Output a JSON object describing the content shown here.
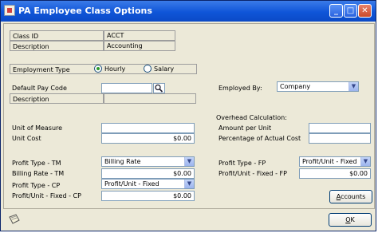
{
  "window": {
    "title": "PA Employee Class Options",
    "min_glyph": "_",
    "max_glyph": "□",
    "close_glyph": "✕"
  },
  "class_id": {
    "label": "Class ID",
    "value": "ACCT"
  },
  "description": {
    "label": "Description",
    "value": "Accounting"
  },
  "employment_type": {
    "label": "Employment Type",
    "options": [
      "Hourly",
      "Salary"
    ],
    "selected": "Hourly"
  },
  "default_pay_code": {
    "label": "Default Pay Code",
    "value": "",
    "desc_label": "Description",
    "desc_value": ""
  },
  "employed_by": {
    "label": "Employed By:",
    "value": "Company"
  },
  "overhead": {
    "title": "Overhead Calculation:",
    "amount_label": "Amount per Unit",
    "amount_value": "",
    "pct_label": "Percentage of Actual Cost",
    "pct_value": ""
  },
  "unit_of_measure": {
    "label": "Unit of Measure",
    "value": ""
  },
  "unit_cost": {
    "label": "Unit Cost",
    "value": "$0.00"
  },
  "profit_type_tm": {
    "label": "Profit Type - TM",
    "value": "Billing Rate"
  },
  "billing_rate_tm": {
    "label": "Billing Rate - TM",
    "value": "$0.00"
  },
  "profit_type_cp": {
    "label": "Profit Type - CP",
    "value": "Profit/Unit - Fixed"
  },
  "profit_unit_fixed_cp": {
    "label": "Profit/Unit - Fixed - CP",
    "value": "$0.00"
  },
  "profit_type_fp": {
    "label": "Profit Type - FP",
    "value": "Profit/Unit - Fixed"
  },
  "profit_unit_fixed_fp": {
    "label": "Profit/Unit - Fixed - FP",
    "value": "$0.00"
  },
  "buttons": {
    "accounts_u": "A",
    "accounts_rest": "ccounts",
    "ok_u": "O",
    "ok_rest": "K"
  },
  "icons": {
    "lookup": "magnifier-icon",
    "dropdown": "chevron-down-icon",
    "note": "note-icon"
  }
}
